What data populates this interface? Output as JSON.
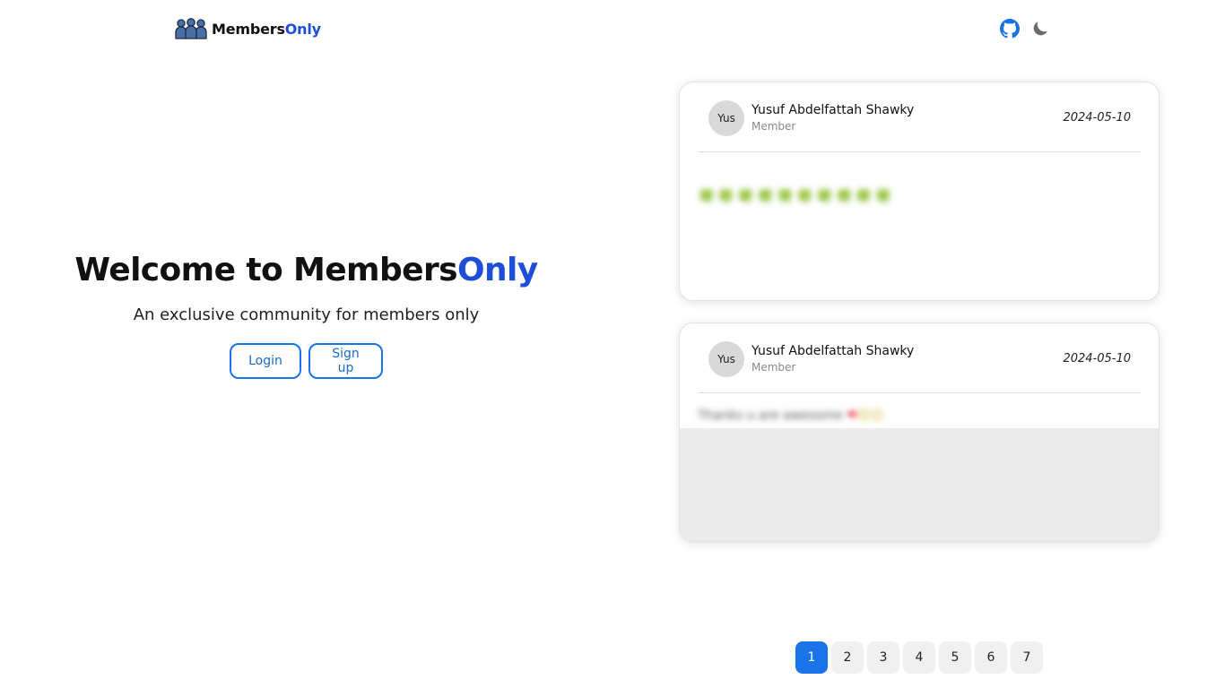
{
  "brand": {
    "name_part1": "Members",
    "name_part2": "Only",
    "accent_color": "#1d4ed8"
  },
  "nav": {
    "icons": [
      "github-icon",
      "moon-icon"
    ]
  },
  "hero": {
    "title_part1": "Welcome to Members",
    "title_part2": "Only",
    "subtitle": "An exclusive community for members only",
    "login_label": "Login",
    "signup_label": "Sign up"
  },
  "posts": [
    {
      "avatar": "Yus",
      "author": "Yusuf Abdelfattah Shawky",
      "role": "Member",
      "date": "2024-05-10",
      "body": "🍀🍀🍀🍀🍀🍀🍀🍀🍀🍀"
    },
    {
      "avatar": "Yus",
      "author": "Yusuf Abdelfattah Shawky",
      "role": "Member",
      "date": "2024-05-10",
      "body_text": "Thanks u are awesome ",
      "body_emoji": [
        "❤",
        "☺",
        "☺"
      ]
    }
  ],
  "pagination": {
    "pages": [
      "1",
      "2",
      "3",
      "4",
      "5",
      "6",
      "7"
    ],
    "active": "1",
    "active_color": "#1a73e8"
  }
}
